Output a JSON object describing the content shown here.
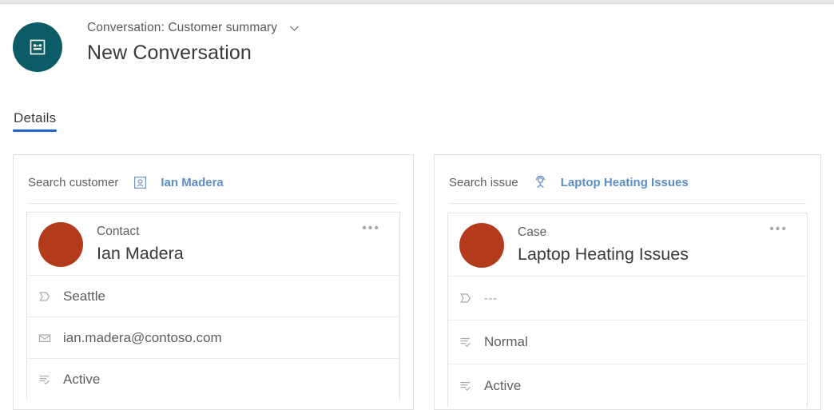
{
  "header": {
    "avatar_icon": "conversation-badge-icon",
    "avatar_color": "#0c5c67",
    "breadcrumb": "Conversation: Customer summary",
    "breadcrumb_chevron_icon": "chevron-down-icon",
    "title": "New Conversation"
  },
  "tabs": [
    {
      "label": "Details",
      "active": true
    }
  ],
  "accent_color": "#2266cc",
  "link_color": "#5c8ec4",
  "avatar_color": "#b33a1b",
  "cards": [
    {
      "side": "left",
      "search": {
        "label": "Search customer",
        "icon": "contact-card-icon",
        "value": "Ian Madera"
      },
      "entity": {
        "avatar_icon": "contact-avatar",
        "type": "Contact",
        "name": "Ian Madera",
        "overflow_label": "•••",
        "attributes": [
          {
            "icon": "location-tag-icon",
            "value": "Seattle",
            "muted": false
          },
          {
            "icon": "email-envelope-icon",
            "value": "ian.madera@contoso.com",
            "muted": false
          },
          {
            "icon": "status-list-check-icon",
            "value": "Active",
            "muted": false
          }
        ]
      }
    },
    {
      "side": "right",
      "search": {
        "label": "Search issue",
        "icon": "person-agent-icon",
        "value": "Laptop Heating Issues"
      },
      "entity": {
        "avatar_icon": "case-avatar",
        "type": "Case",
        "name": "Laptop Heating Issues",
        "overflow_label": "•••",
        "attributes": [
          {
            "icon": "location-tag-icon",
            "value": "---",
            "muted": true
          },
          {
            "icon": "status-list-check-icon",
            "value": "Normal",
            "muted": false
          },
          {
            "icon": "status-list-check-icon",
            "value": "Active",
            "muted": false
          }
        ]
      }
    }
  ]
}
